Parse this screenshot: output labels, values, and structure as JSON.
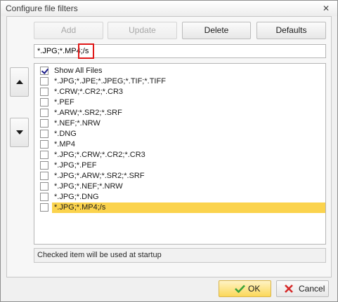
{
  "window": {
    "title": "Configure file filters"
  },
  "toolbar": {
    "add_label": "Add",
    "update_label": "Update",
    "delete_label": "Delete",
    "defaults_label": "Defaults"
  },
  "filter_input": {
    "value": "*.JPG;*.MP4;/s"
  },
  "filters": [
    {
      "label": "Show All Files",
      "checked": true,
      "selected": false
    },
    {
      "label": "*.JPG;*.JPE;*.JPEG;*.TIF;*.TIFF",
      "checked": false,
      "selected": false
    },
    {
      "label": "*.CRW;*.CR2;*.CR3",
      "checked": false,
      "selected": false
    },
    {
      "label": "*.PEF",
      "checked": false,
      "selected": false
    },
    {
      "label": "*.ARW;*.SR2;*.SRF",
      "checked": false,
      "selected": false
    },
    {
      "label": "*.NEF;*.NRW",
      "checked": false,
      "selected": false
    },
    {
      "label": "*.DNG",
      "checked": false,
      "selected": false
    },
    {
      "label": "*.MP4",
      "checked": false,
      "selected": false
    },
    {
      "label": "*.JPG;*.CRW;*.CR2;*.CR3",
      "checked": false,
      "selected": false
    },
    {
      "label": "*.JPG;*.PEF",
      "checked": false,
      "selected": false
    },
    {
      "label": "*.JPG;*.ARW;*.SR2;*.SRF",
      "checked": false,
      "selected": false
    },
    {
      "label": "*.JPG;*.NEF;*.NRW",
      "checked": false,
      "selected": false
    },
    {
      "label": "*.JPG;*.DNG",
      "checked": false,
      "selected": false
    },
    {
      "label": "*.JPG;*.MP4;/s",
      "checked": false,
      "selected": true
    }
  ],
  "status": {
    "text": "Checked item will be used at startup"
  },
  "footer": {
    "ok_label": "OK",
    "cancel_label": "Cancel"
  },
  "colors": {
    "selection": "#fbd34d",
    "highlight_box": "#e01818",
    "ok_check": "#3aa33a",
    "cancel_x": "#d62a2a"
  }
}
